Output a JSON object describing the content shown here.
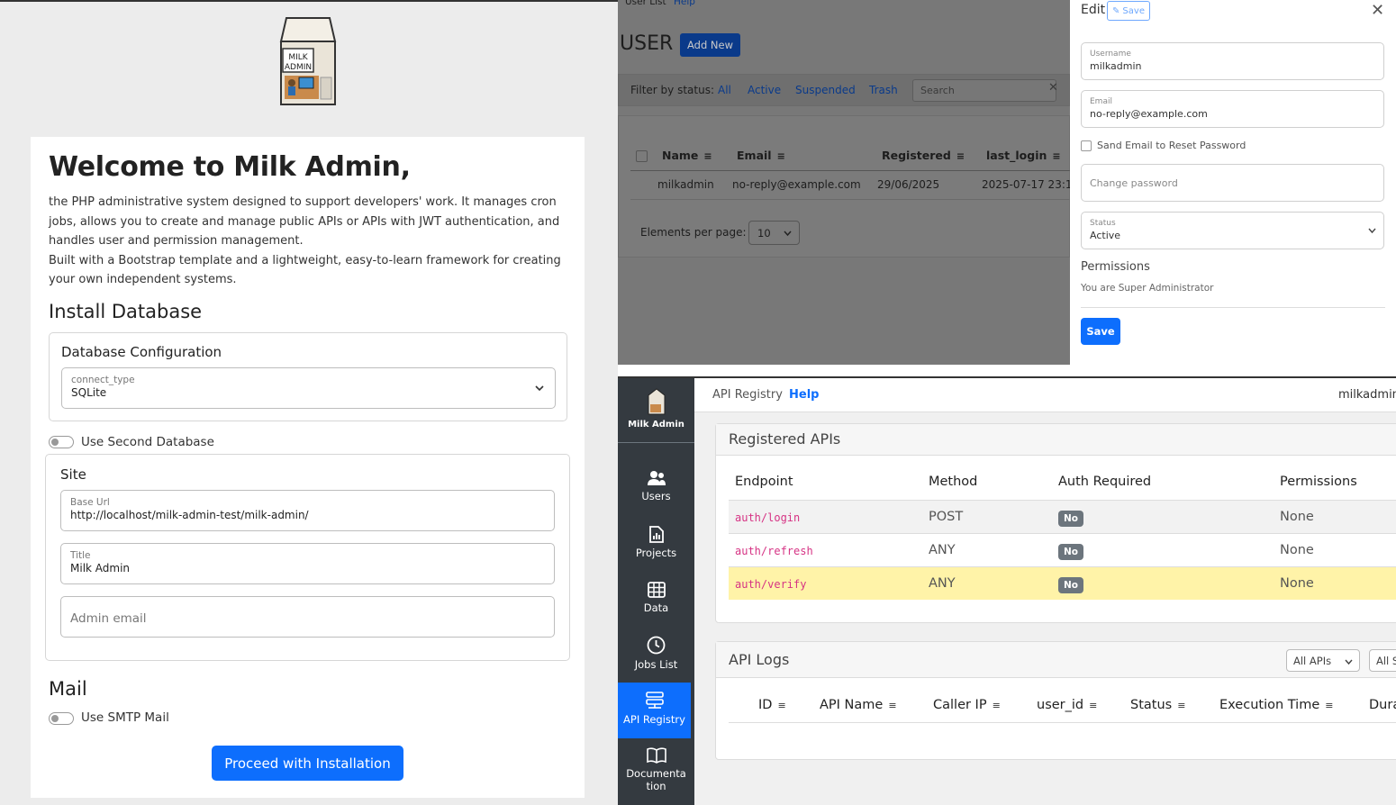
{
  "installer": {
    "logo_text": "MILK ADMIN",
    "title": "Welcome to Milk Admin,",
    "intro_line1": "the PHP administrative system designed to support developers' work. It manages cron jobs, allows you to create and manage public APIs or APIs with JWT authentication, and handles user and permission management.",
    "intro_line2": "Built with a Bootstrap template and a lightweight, easy-to-learn framework for creating your own independent systems.",
    "install_db_heading": "Install Database",
    "db_config_title": "Database Configuration",
    "connect_type_label": "connect_type",
    "connect_type_value": "SQLite",
    "second_db_label": "Use Second Database",
    "site_title": "Site",
    "base_url_label": "Base Url",
    "base_url_value": "http://localhost/milk-admin-test/milk-admin/",
    "title_label": "Title",
    "title_value": "Milk Admin",
    "admin_email_placeholder": "Admin email",
    "mail_heading": "Mail",
    "smtp_label": "Use SMTP Mail",
    "proceed_button": "Proceed with Installation"
  },
  "user_list": {
    "breadcrumb": "User List",
    "help": "Help",
    "title": "USER",
    "add_new": "Add New",
    "filter_label": "Filter by status:",
    "filters": [
      "All",
      "Active",
      "Suspended",
      "Trash"
    ],
    "search_placeholder": "Search",
    "columns": [
      "Name",
      "Email",
      "Registered",
      "last_login"
    ],
    "row": {
      "name": "milkadmin",
      "email": "no-reply@example.com",
      "registered": "29/06/2025",
      "last_login": "2025-07-17 23:1"
    },
    "per_page_label": "Elements per page:",
    "per_page_value": "10"
  },
  "edit_user": {
    "title": "Edit",
    "save_small": "Save",
    "username_label": "Username",
    "username_value": "milkadmin",
    "email_label": "Email",
    "email_value": "no-reply@example.com",
    "reset_checkbox": "Sand Email to Reset Password",
    "password_placeholder": "Change password",
    "status_label": "Status",
    "status_value": "Active",
    "permissions_heading": "Permissions",
    "permissions_text": "You are Super Administrator",
    "save_button": "Save"
  },
  "api_registry": {
    "brand": "Milk Admin",
    "sidebar": [
      {
        "label": "Users",
        "icon": "users-icon"
      },
      {
        "label": "Projects",
        "icon": "file-chart-icon"
      },
      {
        "label": "Data",
        "icon": "table-grid-icon"
      },
      {
        "label": "Jobs List",
        "icon": "clock-icon"
      },
      {
        "label": "API Registry",
        "icon": "api-registry-icon"
      },
      {
        "label": "Documentation",
        "icon": "book-icon"
      }
    ],
    "breadcrumb": "API Registry",
    "help": "Help",
    "user": "milkadmin",
    "registered_title": "Registered APIs",
    "columns": [
      "Endpoint",
      "Method",
      "Auth Required",
      "Permissions"
    ],
    "rows": [
      {
        "endpoint": "auth/login",
        "method": "POST",
        "auth": "No",
        "permissions": "None"
      },
      {
        "endpoint": "auth/refresh",
        "method": "ANY",
        "auth": "No",
        "permissions": "None"
      },
      {
        "endpoint": "auth/verify",
        "method": "ANY",
        "auth": "No",
        "permissions": "None"
      }
    ],
    "logs_title": "API Logs",
    "logs_filter1": "All APIs",
    "logs_filter2": "All S",
    "log_columns": [
      "ID",
      "API Name",
      "Caller IP",
      "user_id",
      "Status",
      "Execution Time",
      "Dura"
    ]
  },
  "colors": {
    "primary": "#0d6efd",
    "sidebar_bg": "#343a40",
    "highlight_row": "#fff3a8",
    "code_pink": "#d63384"
  }
}
